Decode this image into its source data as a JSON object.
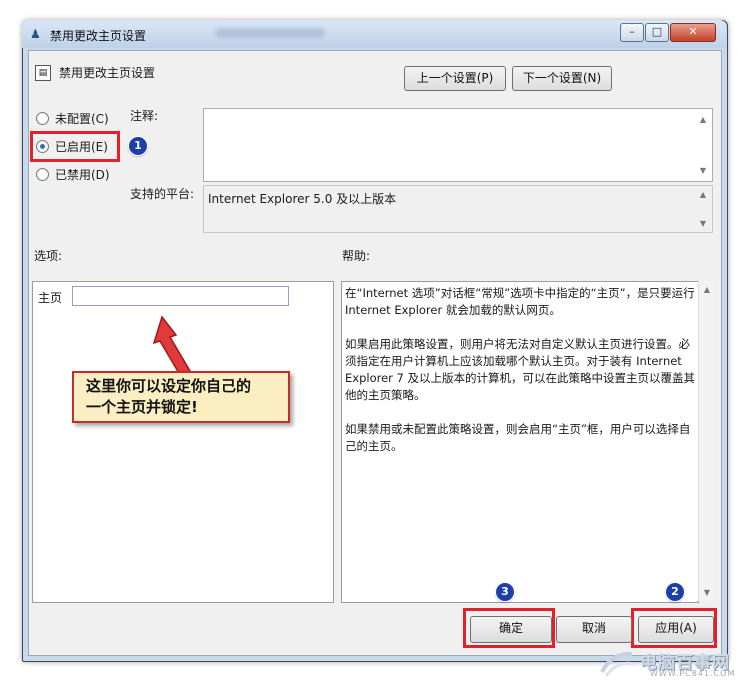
{
  "window": {
    "title": "禁用更改主页设置",
    "minimize": "–",
    "maximize": "□",
    "close": "✕"
  },
  "header": {
    "title": "禁用更改主页设置",
    "prev_button": "上一个设置(P)",
    "next_button": "下一个设置(N)"
  },
  "state": {
    "options": [
      {
        "label": "未配置(C)",
        "selected": false
      },
      {
        "label": "已启用(E)",
        "selected": true
      },
      {
        "label": "已禁用(D)",
        "selected": false
      }
    ]
  },
  "comment": {
    "label": "注释:",
    "value": ""
  },
  "platform": {
    "label": "支持的平台:",
    "value": "Internet Explorer 5.0 及以上版本"
  },
  "options_panel": {
    "label": "选项:",
    "homepage_label": "主页",
    "homepage_value": ""
  },
  "help_panel": {
    "label": "帮助:",
    "paragraphs": [
      "在“Internet 选项”对话框“常规”选项卡中指定的“主页”，是只要运行 Internet Explorer 就会加载的默认网页。",
      "如果启用此策略设置，则用户将无法对自定义默认主页进行设置。必须指定在用户计算机上应该加载哪个默认主页。对于装有 Internet Explorer 7 及以上版本的计算机，可以在此策略中设置主页以覆盖其他的主页策略。",
      "如果禁用或未配置此策略设置，则会启用“主页”框，用户可以选择自己的主页。"
    ]
  },
  "annotation": {
    "callout_line1": "这里你可以设定你自己的",
    "callout_line2": "一个主页并锁定!",
    "badge_1": "1",
    "badge_2": "2",
    "badge_3": "3",
    "accent_color": "#e0202a",
    "badge_color": "#1e3fa8"
  },
  "footer": {
    "ok_button": "确定",
    "cancel_button": "取消",
    "apply_button": "应用(A)"
  },
  "watermark": {
    "text": "电脑百事网",
    "url": "WWW.PC841.COM"
  }
}
